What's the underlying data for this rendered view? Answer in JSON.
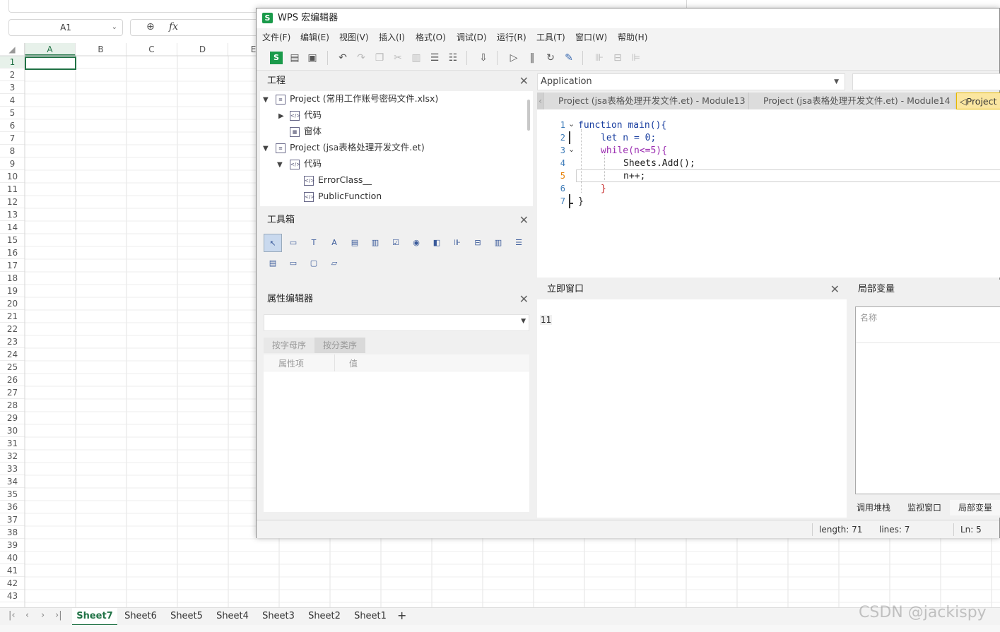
{
  "spreadsheet": {
    "name_box": "A1",
    "columns": [
      "A",
      "B",
      "C",
      "D",
      "E"
    ],
    "rows": [
      "1",
      "2",
      "3",
      "4",
      "5",
      "6",
      "7",
      "8",
      "9",
      "10",
      "11",
      "12",
      "13",
      "14",
      "15",
      "16",
      "17",
      "18",
      "19",
      "20",
      "21",
      "22",
      "23",
      "24",
      "25",
      "26",
      "27",
      "28",
      "29",
      "30",
      "31",
      "32",
      "33",
      "34",
      "35",
      "36",
      "37",
      "38",
      "39",
      "40",
      "41",
      "42",
      "43"
    ],
    "sheets": [
      "Sheet7",
      "Sheet6",
      "Sheet5",
      "Sheet4",
      "Sheet3",
      "Sheet2",
      "Sheet1"
    ],
    "active_sheet": "Sheet7",
    "add_sheet": "+",
    "watermark": "CSDN @jackispy"
  },
  "editor": {
    "title": "WPS 宏编辑器",
    "logo": "S",
    "menu": [
      "文件(F)",
      "编辑(E)",
      "视图(V)",
      "插入(I)",
      "格式(O)",
      "调试(D)",
      "运行(R)",
      "工具(T)",
      "窗口(W)",
      "帮助(H)"
    ],
    "project_panel": {
      "title": "工程",
      "tree": [
        {
          "label": "Project (常用工作账号密码文件.xlsx)",
          "level": 0,
          "expanded": true
        },
        {
          "label": "代码",
          "level": 1,
          "expanded": false
        },
        {
          "label": "窗体",
          "level": 1
        },
        {
          "label": "Project (jsa表格处理开发文件.et)",
          "level": 0,
          "expanded": true
        },
        {
          "label": "代码",
          "level": 1,
          "expanded": true
        },
        {
          "label": "ErrorClass__",
          "level": 2
        },
        {
          "label": "PublicFunction",
          "level": 2
        }
      ]
    },
    "toolbox_panel": {
      "title": "工具箱"
    },
    "property_panel": {
      "title": "属性编辑器",
      "tabs": [
        "按字母序",
        "按分类序"
      ],
      "columns": [
        "属性项",
        "值"
      ]
    },
    "object_combo": "Application",
    "code_tabs": [
      "Project (jsa表格处理开发文件.et) - Module13",
      "Project (jsa表格处理开发文件.et) - Module14",
      "Project"
    ],
    "code_lines": [
      {
        "num": "1",
        "text": "function main(){"
      },
      {
        "num": "2",
        "text": "let n = 0;"
      },
      {
        "num": "3",
        "text": "while(n<=5){"
      },
      {
        "num": "4",
        "text": "Sheets.Add();"
      },
      {
        "num": "5",
        "text": "n++;"
      },
      {
        "num": "6",
        "text": "}"
      },
      {
        "num": "7",
        "text": "}"
      }
    ],
    "immediate_panel": {
      "title": "立即窗口",
      "output": "11"
    },
    "locals_panel": {
      "title": "局部变量",
      "column": "名称",
      "tabs": [
        "调用堆栈",
        "监视窗口",
        "局部变量"
      ]
    },
    "status": {
      "length": "length: 71",
      "lines": "lines: 7",
      "ln": "Ln: 5"
    }
  }
}
